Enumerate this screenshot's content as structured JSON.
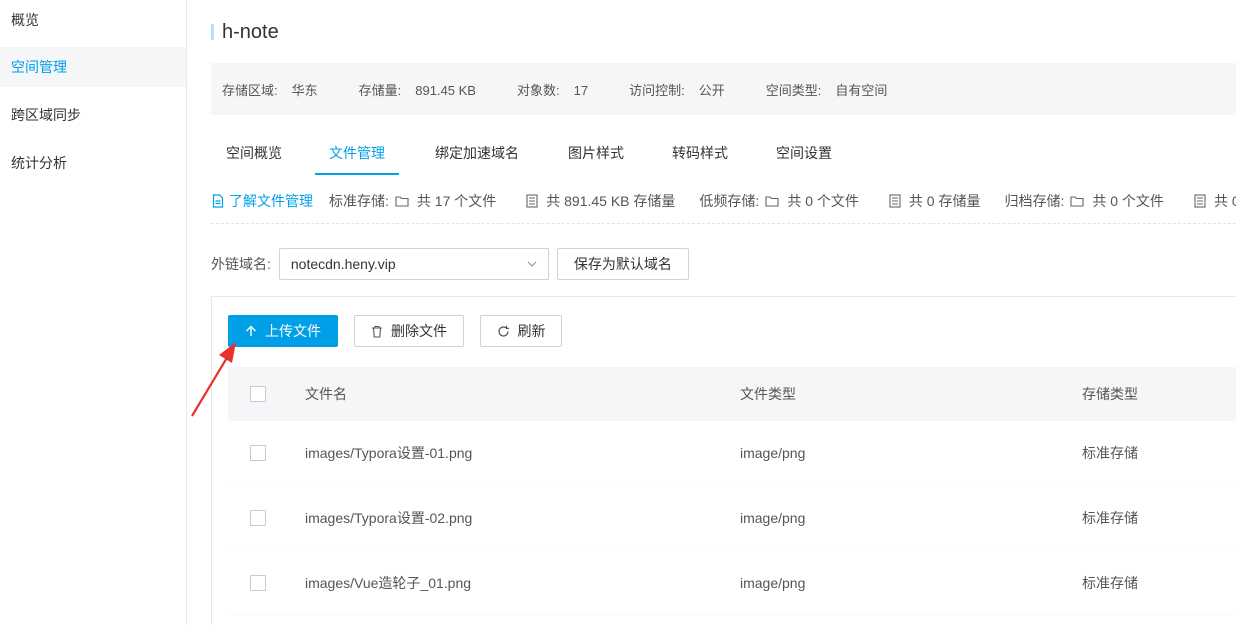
{
  "sidebar": {
    "items": [
      {
        "label": "概览"
      },
      {
        "label": "空间管理"
      },
      {
        "label": "跨区域同步"
      },
      {
        "label": "统计分析"
      }
    ]
  },
  "bucket": {
    "name": "h-note",
    "info": [
      {
        "key": "存储区域:",
        "value": "华东"
      },
      {
        "key": "存储量:",
        "value": "891.45 KB"
      },
      {
        "key": "对象数:",
        "value": "17"
      },
      {
        "key": "访问控制:",
        "value": "公开"
      },
      {
        "key": "空间类型:",
        "value": "自有空间"
      }
    ]
  },
  "tabs": [
    {
      "label": "空间概览"
    },
    {
      "label": "文件管理"
    },
    {
      "label": "绑定加速域名"
    },
    {
      "label": "图片样式"
    },
    {
      "label": "转码样式"
    },
    {
      "label": "空间设置"
    }
  ],
  "stats": {
    "learn_link": "了解文件管理",
    "standard_label": "标准存储:",
    "standard_files": "共 17 个文件",
    "standard_size": "共 891.45 KB 存储量",
    "low_label": "低频存储:",
    "low_files": "共 0 个文件",
    "low_size": "共 0 存储量",
    "archive_label": "归档存储:",
    "archive_files": "共 0 个文件",
    "archive_size": "共 0"
  },
  "domain": {
    "label": "外链域名:",
    "value": "notecdn.heny.vip",
    "save_button": "保存为默认域名"
  },
  "toolbar": {
    "upload": "上传文件",
    "delete": "删除文件",
    "refresh": "刷新"
  },
  "table": {
    "columns": [
      "文件名",
      "文件类型",
      "存储类型"
    ],
    "rows": [
      [
        "images/Typora设置-01.png",
        "image/png",
        "标准存储"
      ],
      [
        "images/Typora设置-02.png",
        "image/png",
        "标准存储"
      ],
      [
        "images/Vue造轮子_01.png",
        "image/png",
        "标准存储"
      ]
    ]
  },
  "colors": {
    "accent": "#00a0e9",
    "annotation_arrow": "#e5322d"
  }
}
